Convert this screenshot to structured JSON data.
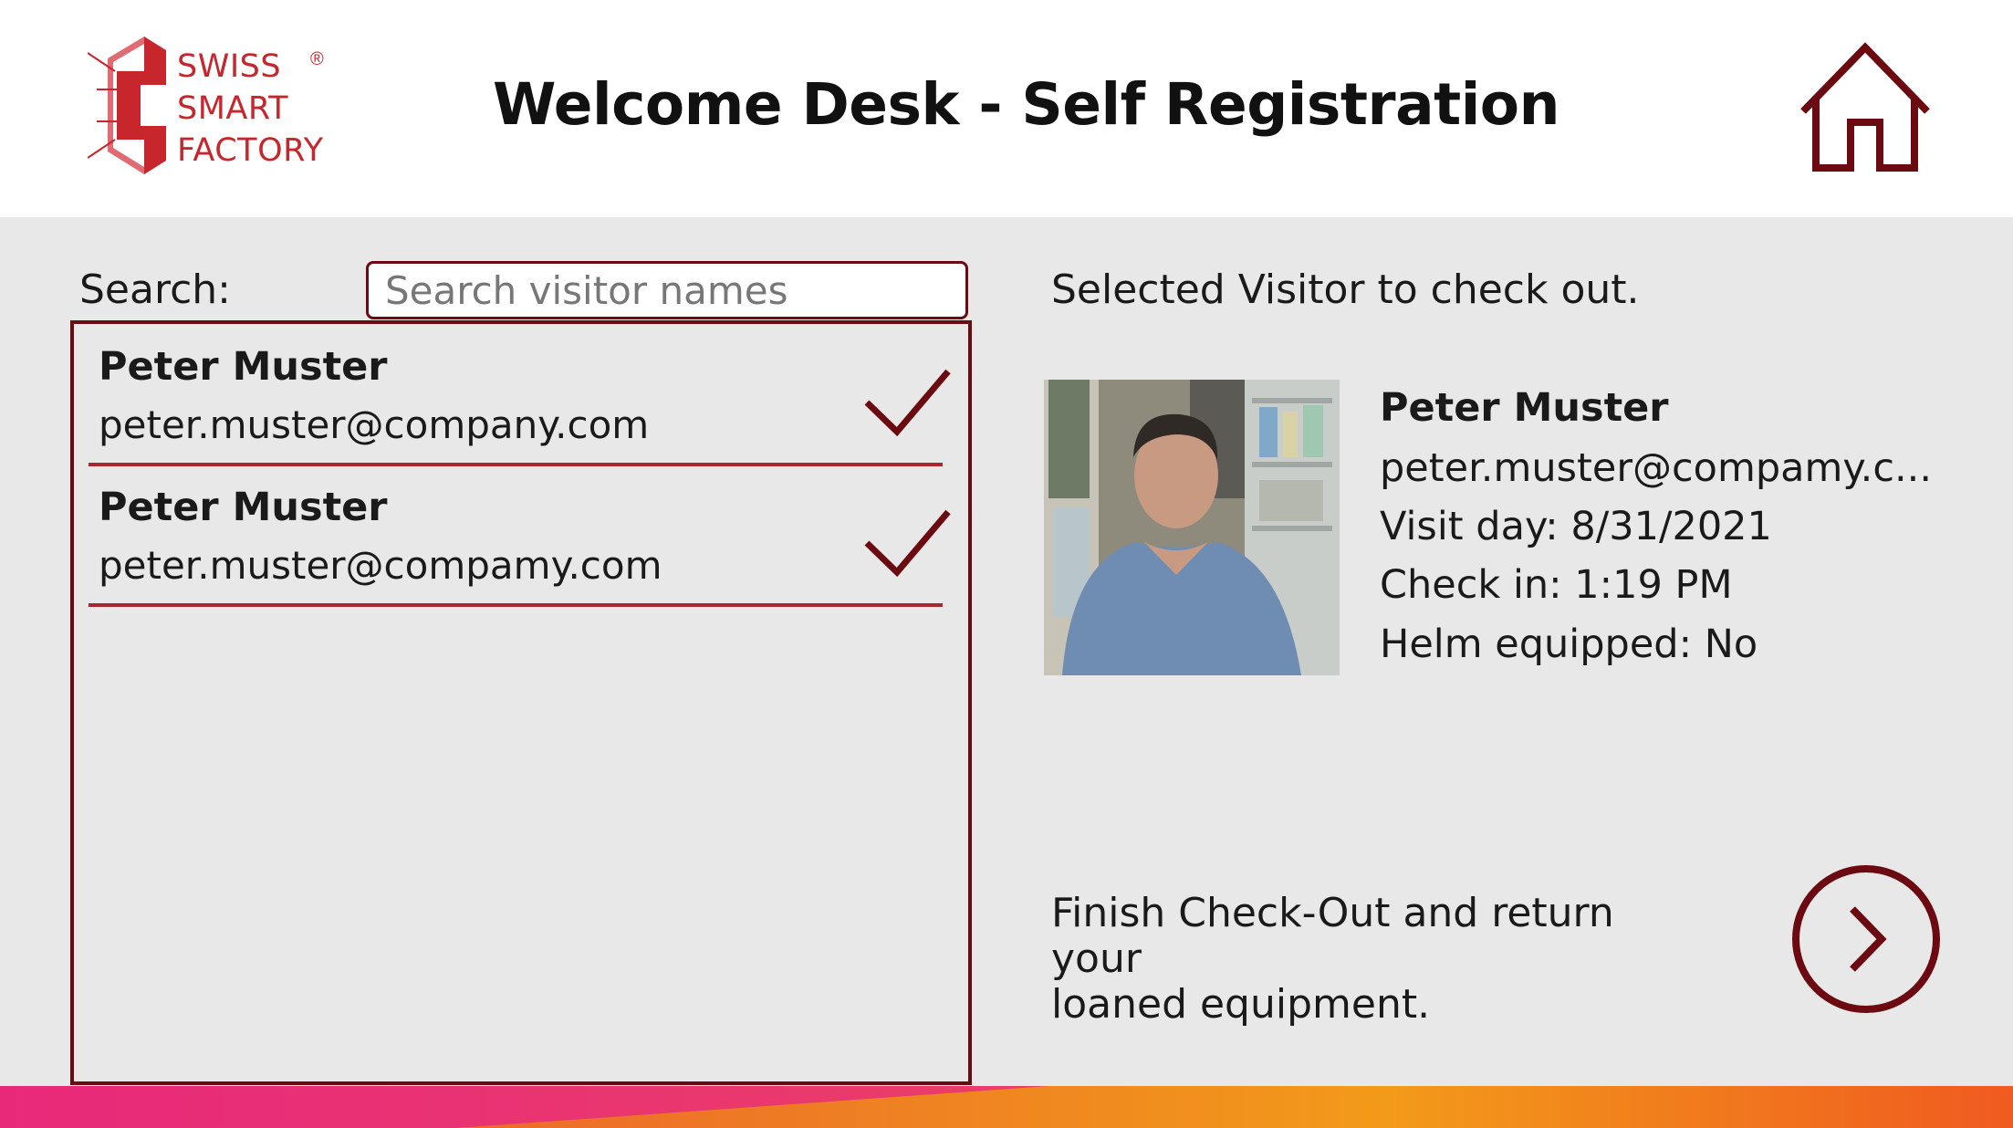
{
  "brand": {
    "logo_lines": [
      "SWISS",
      "SMART",
      "FACTORY"
    ],
    "registered_mark": "®",
    "accent_color": "#6b0a10",
    "logo_color": "#c8262d"
  },
  "header": {
    "title": "Welcome Desk - Self Registration",
    "home_icon": "home-icon"
  },
  "search": {
    "label": "Search:",
    "placeholder": "Search visitor names",
    "value": ""
  },
  "visitors": [
    {
      "name": "Peter Muster",
      "email": "peter.muster@company.com",
      "status_icon": "checkmark-icon"
    },
    {
      "name": "Peter Muster",
      "email": "peter.muster@compamy.com",
      "status_icon": "checkmark-icon"
    }
  ],
  "selected": {
    "heading": "Selected Visitor to check out.",
    "name": "Peter Muster",
    "email": "peter.muster@compamy.c...",
    "visit_day": "Visit day: 8/31/2021",
    "check_in": "Check in: 1:19 PM",
    "helm": "Helm equipped: No"
  },
  "finish": {
    "text_line1": "Finish Check-Out and return your",
    "text_line2": "loaned equipment.",
    "next_icon": "chevron-right-icon"
  }
}
